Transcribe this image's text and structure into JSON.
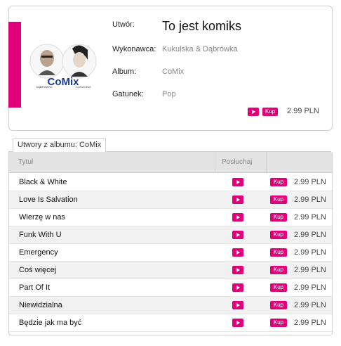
{
  "product": {
    "labels": {
      "track": "Utwór:",
      "artist": "Wykonawca:",
      "album": "Album:",
      "genre": "Gatunek:"
    },
    "track_title": "To jest komiks",
    "artist": "Kukulska & Dąbrówka",
    "album": "CoMix",
    "genre": "Pop",
    "buy_label": "Kup",
    "price": "2.99 PLN",
    "cover": {
      "logo_text": "CoMix",
      "left_caption": "DĄBRÓWKA",
      "right_caption": "KUKULSKA"
    }
  },
  "album_tab": {
    "label": "Utwory z albumu: CoMix",
    "headers": {
      "title": "Tytuł",
      "listen": "Posłuchaj"
    },
    "tracks": [
      {
        "title": "Black & White",
        "buy": "Kup",
        "price": "2.99 PLN"
      },
      {
        "title": "Love Is Salvation",
        "buy": "Kup",
        "price": "2.99 PLN"
      },
      {
        "title": "Wierzę w nas",
        "buy": "Kup",
        "price": "2.99 PLN"
      },
      {
        "title": "Funk With U",
        "buy": "Kup",
        "price": "2.99 PLN"
      },
      {
        "title": "Emergency",
        "buy": "Kup",
        "price": "2.99 PLN"
      },
      {
        "title": "Coś więcej",
        "buy": "Kup",
        "price": "2.99 PLN"
      },
      {
        "title": "Part Of It",
        "buy": "Kup",
        "price": "2.99 PLN"
      },
      {
        "title": "Niewidzialna",
        "buy": "Kup",
        "price": "2.99 PLN"
      },
      {
        "title": "Będzie jak ma być",
        "buy": "Kup",
        "price": "2.99 PLN"
      }
    ]
  },
  "colors": {
    "accent": "#e0007a",
    "border": "#cfcfcf",
    "header_bg": "#e3e3e3"
  },
  "icons": {
    "play": "play-icon"
  }
}
